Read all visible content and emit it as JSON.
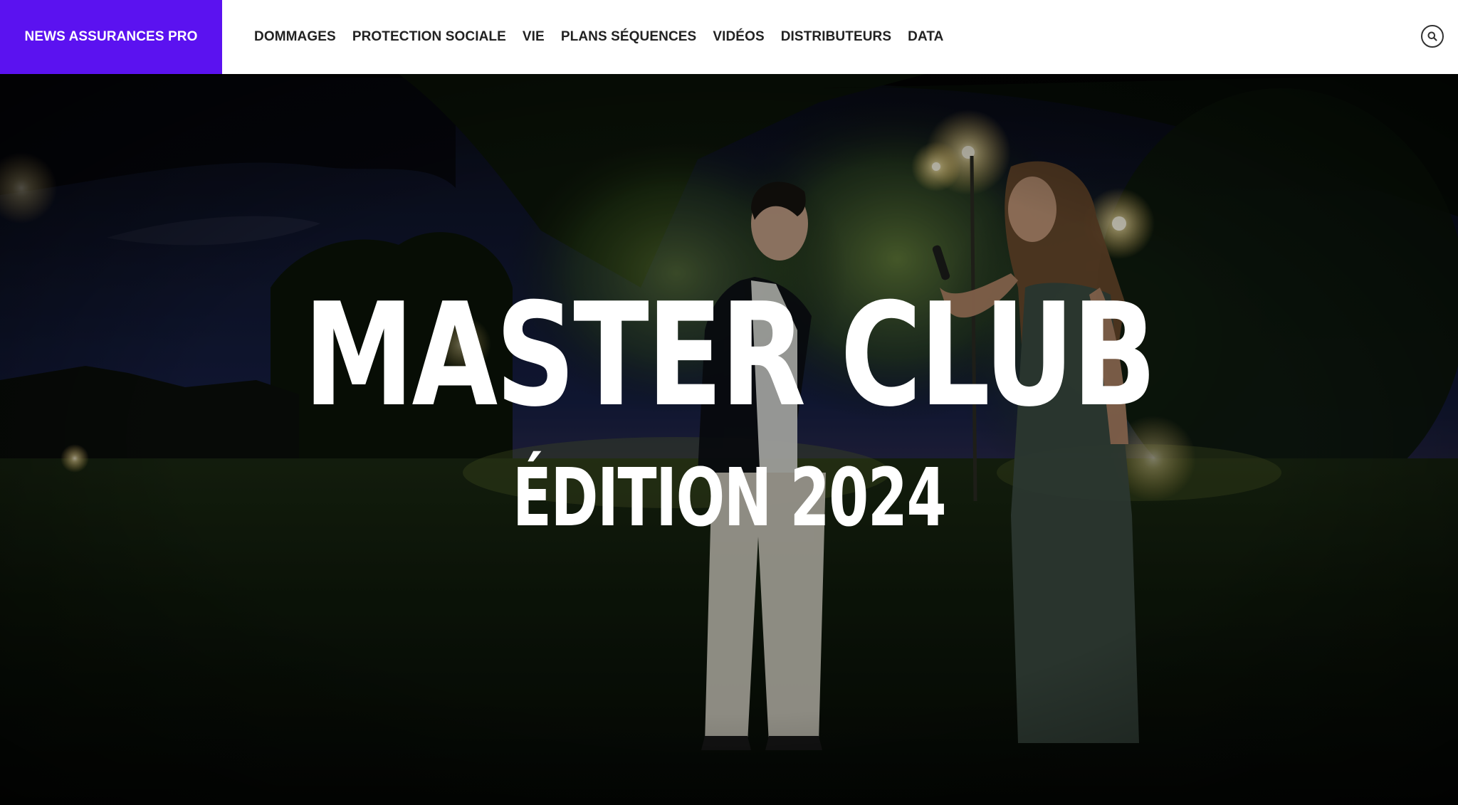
{
  "header": {
    "brand": "NEWS ASSURANCES PRO",
    "nav": [
      "DOMMAGES",
      "PROTECTION SOCIALE",
      "VIE",
      "PLANS SÉQUENCES",
      "VIDÉOS",
      "DISTRIBUTEURS",
      "DATA"
    ],
    "search_icon": "search-icon"
  },
  "hero": {
    "title": "MASTER CLUB",
    "subtitle": "ÉDITION 2024"
  },
  "colors": {
    "brand": "#5b12f0",
    "header_bg": "#ffffff",
    "nav_text": "#222222",
    "hero_text": "#ffffff"
  }
}
